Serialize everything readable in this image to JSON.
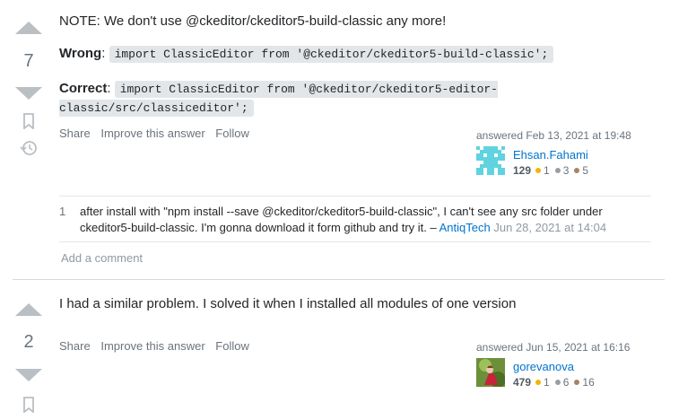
{
  "answers": [
    {
      "score": "7",
      "note": "NOTE: We don't use @ckeditor/ckeditor5-build-classic any more!",
      "wrong_label": "Wrong",
      "wrong_code": "import ClassicEditor from '@ckeditor/ckeditor5-build-classic';",
      "correct_label": "Correct",
      "correct_code": "import ClassicEditor from '@ckeditor/ckeditor5-editor-classic/src/classiceditor';",
      "menu": {
        "share": "Share",
        "improve": "Improve this answer",
        "follow": "Follow"
      },
      "signature": {
        "action": "answered Feb 13, 2021 at 19:48",
        "user": "Ehsan.Fahami",
        "reputation": "129",
        "gold": "1",
        "silver": "3",
        "bronze": "5"
      },
      "comments": [
        {
          "score": "1",
          "text": "after install with \"npm install --save @ckeditor/ckeditor5-build-classic\", I can't see any src folder under ckeditor5-build-classic. I'm gonna download it form github and try it. – ",
          "user": "AntiqTech",
          "date": "Jun 28, 2021 at 14:04"
        }
      ],
      "add_comment": "Add a comment"
    },
    {
      "score": "2",
      "body": "I had a similar problem. I solved it when I installed all modules of one version",
      "menu": {
        "share": "Share",
        "improve": "Improve this answer",
        "follow": "Follow"
      },
      "signature": {
        "action": "answered Jun 15, 2021 at 16:16",
        "user": "gorevanova",
        "reputation": "479",
        "gold": "1",
        "silver": "6",
        "bronze": "16"
      }
    }
  ],
  "colors": {
    "link": "#0074cc",
    "arrow": "#babfc4",
    "gold": "#f1b600",
    "silver": "#9a9ea2",
    "bronze": "#ab8260"
  }
}
